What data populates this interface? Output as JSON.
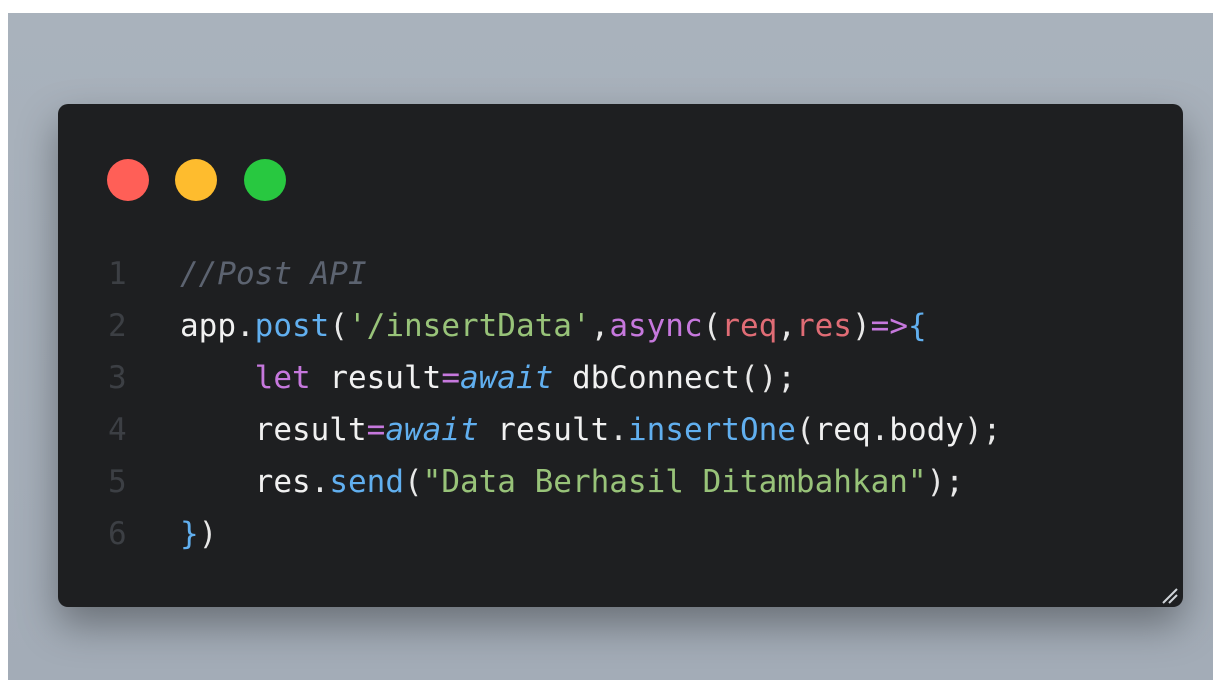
{
  "window": {
    "traffic_lights": [
      {
        "name": "close",
        "color": "#ff5f57"
      },
      {
        "name": "minimize",
        "color": "#febc2e"
      },
      {
        "name": "maximize",
        "color": "#28c840"
      }
    ]
  },
  "code": {
    "lines": [
      {
        "number": "1",
        "tokens": [
          {
            "t": "//Post API",
            "k": "comment"
          }
        ]
      },
      {
        "number": "2",
        "tokens": [
          {
            "t": "app",
            "k": "ident"
          },
          {
            "t": ".",
            "k": "punct"
          },
          {
            "t": "post",
            "k": "method"
          },
          {
            "t": "(",
            "k": "paren"
          },
          {
            "t": "'/insertData'",
            "k": "string"
          },
          {
            "t": ",",
            "k": "punct"
          },
          {
            "t": "async",
            "k": "keyword"
          },
          {
            "t": "(",
            "k": "paren"
          },
          {
            "t": "req",
            "k": "param"
          },
          {
            "t": ",",
            "k": "punct"
          },
          {
            "t": "res",
            "k": "param"
          },
          {
            "t": ")",
            "k": "paren"
          },
          {
            "t": "=>",
            "k": "arrow"
          },
          {
            "t": "{",
            "k": "brace"
          }
        ]
      },
      {
        "number": "3",
        "tokens": [
          {
            "t": "    ",
            "k": "punct"
          },
          {
            "t": "let",
            "k": "keyword"
          },
          {
            "t": " result",
            "k": "ident"
          },
          {
            "t": "=",
            "k": "arrow"
          },
          {
            "t": "await",
            "k": "await"
          },
          {
            "t": " dbConnect",
            "k": "ident"
          },
          {
            "t": "();",
            "k": "punct"
          }
        ]
      },
      {
        "number": "4",
        "tokens": [
          {
            "t": "    ",
            "k": "punct"
          },
          {
            "t": "result",
            "k": "ident"
          },
          {
            "t": "=",
            "k": "arrow"
          },
          {
            "t": "await",
            "k": "await"
          },
          {
            "t": " result",
            "k": "ident"
          },
          {
            "t": ".",
            "k": "punct"
          },
          {
            "t": "insertOne",
            "k": "method"
          },
          {
            "t": "(",
            "k": "paren"
          },
          {
            "t": "req",
            "k": "ident"
          },
          {
            "t": ".",
            "k": "punct"
          },
          {
            "t": "body",
            "k": "ident"
          },
          {
            "t": ");",
            "k": "punct"
          }
        ]
      },
      {
        "number": "5",
        "tokens": [
          {
            "t": "    ",
            "k": "punct"
          },
          {
            "t": "res",
            "k": "ident"
          },
          {
            "t": ".",
            "k": "punct"
          },
          {
            "t": "send",
            "k": "method"
          },
          {
            "t": "(",
            "k": "paren"
          },
          {
            "t": "\"Data Berhasil Ditambahkan\"",
            "k": "string"
          },
          {
            "t": ");",
            "k": "punct"
          }
        ]
      },
      {
        "number": "6",
        "tokens": [
          {
            "t": "}",
            "k": "brace"
          },
          {
            "t": ")",
            "k": "paren"
          }
        ]
      }
    ]
  }
}
